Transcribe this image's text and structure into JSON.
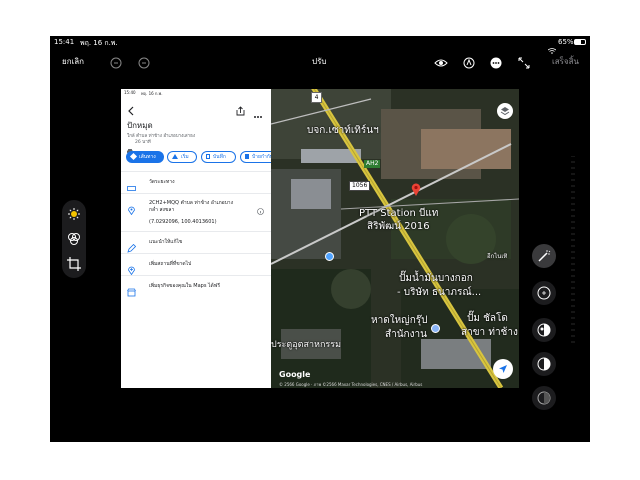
{
  "status": {
    "time": "15:41",
    "date": "พฤ. 16 ก.พ.",
    "wifi": "wifi-icon",
    "battery": "65%"
  },
  "toolbar": {
    "cancel": "ยกเลิก",
    "title": "ปรับ",
    "done": "เสร็จสิ้น"
  },
  "maps_panel": {
    "status_time": "15:40",
    "status_date": "พฤ. 16 ก.พ.",
    "title": "ปักหมุด",
    "subtitle": "ใกล้ ตำบล ท่าข้าง อำเภอบางเสาธง",
    "travel": "26 นาที",
    "chips": [
      "เส้นทาง",
      "เริ่ม",
      "บันทึก",
      "ป้ายกำกับ"
    ],
    "rows": {
      "share": "วัดระยะทาง",
      "address_line1": "2CH2+MQQ ตำบล ท่าข้าง อำเภอบาง",
      "address_line2": "กล่ำ สงขลา",
      "coords": "(7.0292096, 100.4013601)",
      "suggest": "แนะนำให้แก้ไข",
      "add_place": "เพิ่มสถานที่ที่ขาดไป",
      "add_business": "เพิ่มธุรกิจของคุณใน Maps ได้ฟรี"
    }
  },
  "map": {
    "road_4": "4",
    "ah2": "AH2",
    "r1056": "1056",
    "label_company": "บจก.เซาท์เทิร์นฯ",
    "label_ptt_1": "PTT Station บีแท",
    "label_ptt_2": "สิริพัฒน์ 2016",
    "label_cable": "อีกไนเทิ",
    "label_pump_1": "ปั๊มน้ำมันบางกอก",
    "label_pump_2": "- บริษัท ธนาภรณ์...",
    "label_hatyai_1": "หาดใหญ่กรุ๊ป",
    "label_hatyai_2": "สำนักงาน",
    "label_pump2_1": "ปั๊ม ชัลโด",
    "label_pump2_2": "สาขา ท่าช้าง",
    "label_industry": "ประตูอุตสาหกรรม",
    "google": "Google",
    "copyright": "© 2566 Google · ภาพ ©2566 Maxar Technologies, CNES / Airbus, Airbus"
  }
}
